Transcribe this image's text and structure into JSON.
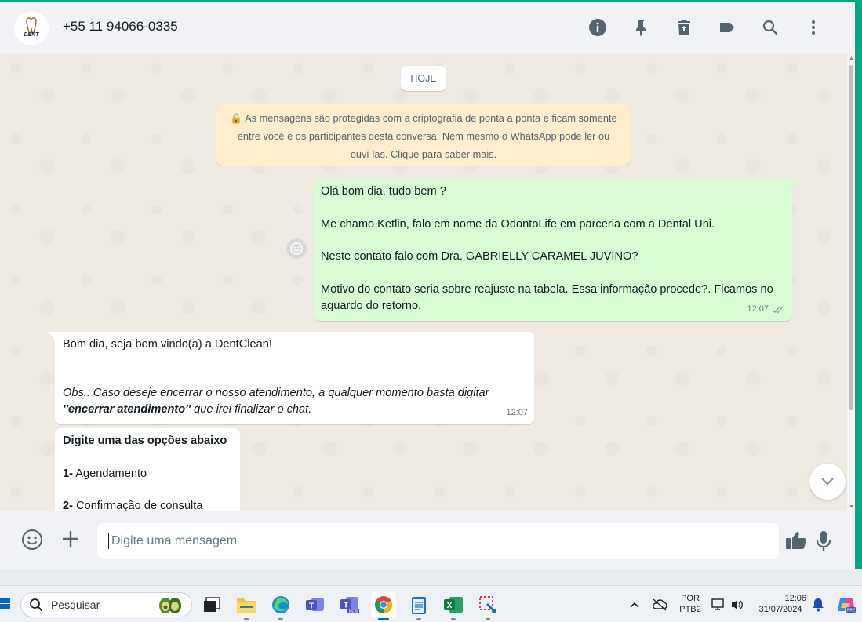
{
  "header": {
    "contact_name": "+55 11 94066-0335",
    "avatar_text": "DENT"
  },
  "chat": {
    "date_chip": "HOJE",
    "encryption_notice": "🔒 As mensagens são protegidas com a criptografia de ponta a ponta e ficam somente entre você e os participantes desta conversa. Nem mesmo o WhatsApp pode ler ou ouvi-las. Clique para saber mais.",
    "outgoing": {
      "line1": "Olá bom dia, tudo bem ?",
      "line2": "Me chamo Ketlin, falo em nome da OdontoLife em parceria com a Dental Uni.",
      "line3": "Neste contato falo com Dra. GABRIELLY CARAMEL JUVINO?",
      "line4": "Motivo do contato seria sobre reajuste na tabela. Essa informação procede?. Ficamos no aguardo do retorno.",
      "time": "12:07"
    },
    "incoming": {
      "line1": "Bom dia, seja bem vindo(a) a DentClean!",
      "obs_prefix": "Obs.: Caso deseje encerrar o nosso atendimento, a qualquer momento basta digitar ",
      "obs_bold": "''encerrar atendimento''",
      "obs_suffix": " que irei finalizar o chat.",
      "time": "12:07"
    },
    "menu": {
      "title": "Digite uma das opções abaixo",
      "opt1_num": "1-",
      "opt1_text": " Agendamento",
      "opt2_num": "2-",
      "opt2_text": " Confirmação de consulta"
    }
  },
  "composer": {
    "placeholder": "Digite uma mensagem"
  },
  "taskbar": {
    "search_label": "Pesquisar",
    "lang_line1": "POR",
    "lang_line2": "PTB2",
    "time": "12:06",
    "date": "31/07/2024"
  },
  "colors": {
    "accent": "#00a884",
    "outgoing_bubble": "#d9fdd3",
    "notice_bg": "#ffeecd"
  }
}
